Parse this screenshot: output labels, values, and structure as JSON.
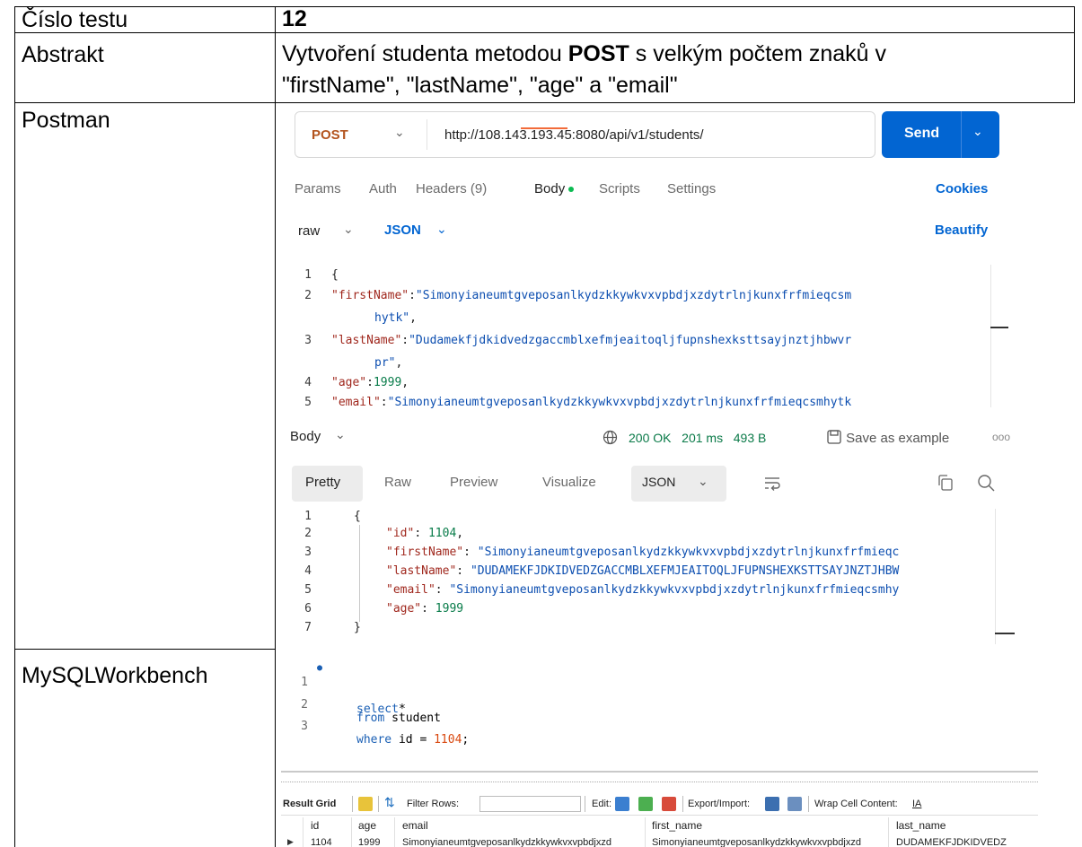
{
  "doc": {
    "rows": [
      {
        "label": "Číslo testu",
        "value": "12"
      },
      {
        "label": "Abstrakt",
        "value_parts": [
          "Vytvoření studenta metodou ",
          "POST",
          " s velkým počtem znaků v",
          "\"firstName\", \"lastName\", \"age\" a \"email\""
        ]
      },
      {
        "label": "Postman"
      },
      {
        "label": "MySQLWorkbench"
      }
    ]
  },
  "postman": {
    "method": "POST",
    "url": "http://108.143.193.45:8080/api/v1/students/",
    "send_label": "Send",
    "tabs": [
      "Params",
      "Auth",
      "Headers (9)",
      "Body",
      "Scripts",
      "Settings"
    ],
    "active_tab": "Body",
    "cookies_label": "Cookies",
    "body_mode": "raw",
    "body_format": "JSON",
    "beautify_label": "Beautify",
    "request_lines": [
      {
        "n": "1",
        "text": "{"
      },
      {
        "n": "2",
        "key": "\"firstName\"",
        "sep": ":",
        "val": "\"Simonyianeumtgveposanlkydzkkywkvxvpbdjxzdytrlnjkunxfrfmieqcsm"
      },
      {
        "n": "",
        "cont": "hytk\"",
        "tail": ","
      },
      {
        "n": "3",
        "key": "\"lastName\"",
        "sep": ":",
        "val": "\"Dudamekfjdkidvedzgaccmblxefmjeaitoqljfupnshexksttsayjnztjhbwvr"
      },
      {
        "n": "",
        "cont": "pr\"",
        "tail": ","
      },
      {
        "n": "4",
        "key": "\"age\"",
        "sep": ":",
        "num": "1999",
        "tail": ","
      },
      {
        "n": "5",
        "key": "\"email\"",
        "sep": ":",
        "val": "\"Simonyianeumtgveposanlkydzkkywkvxvpbdjxzdytrlnjkunxfrfmieqcsmhytk"
      }
    ],
    "response": {
      "section_label": "Body",
      "status": "200 OK",
      "time": "201 ms",
      "size": "493 B",
      "save_label": "Save as example",
      "more": "ooo",
      "views": [
        "Pretty",
        "Raw",
        "Preview",
        "Visualize"
      ],
      "active_view": "Pretty",
      "format": "JSON",
      "lines": [
        {
          "n": "1",
          "text": "{"
        },
        {
          "n": "2",
          "key": "\"id\"",
          "num": "1104",
          "tail": ","
        },
        {
          "n": "3",
          "key": "\"firstName\"",
          "val": "\"Simonyianeumtgveposanlkydzkkywkvxvpbdjxzdytrlnjkunxfrfmieqc"
        },
        {
          "n": "4",
          "key": "\"lastName\"",
          "val": "\"DUDAMEKFJDKIDVEDZGACCMBLXEFMJEAITOQLJFUPNSHEXKSTTSAYJNZTJHBW"
        },
        {
          "n": "5",
          "key": "\"email\"",
          "val": "\"Simonyianeumtgveposanlkydzkkywkvxvpbdjxzdytrlnjkunxfrfmieqcsmhy"
        },
        {
          "n": "6",
          "key": "\"age\"",
          "num": "1999"
        },
        {
          "n": "7",
          "text": "}"
        }
      ]
    }
  },
  "mysql": {
    "sql_lines": [
      {
        "n": "1",
        "kw": "select",
        "rest": "*"
      },
      {
        "n": "2",
        "kw": "from",
        "rest": " student"
      },
      {
        "n": "3",
        "kw": "where",
        "rest": " id = ",
        "num": "1104",
        "tail": ";"
      }
    ],
    "toolbar": {
      "result_grid": "Result Grid",
      "filter_rows": "Filter Rows:",
      "edit": "Edit:",
      "export_import": "Export/Import:",
      "wrap": "Wrap Cell Content:",
      "wrap_icon": "IA"
    },
    "columns": [
      "id",
      "age",
      "email",
      "first_name",
      "last_name"
    ],
    "row": [
      "1104",
      "1999",
      "Simonyianeumtgveposanlkydzkkywkvxvpbdjxzd",
      "Simonyianeumtgveposanlkydzkkywkvxvpbdjxzd",
      "DUDAMEKFJDKIDVEDZ"
    ]
  }
}
